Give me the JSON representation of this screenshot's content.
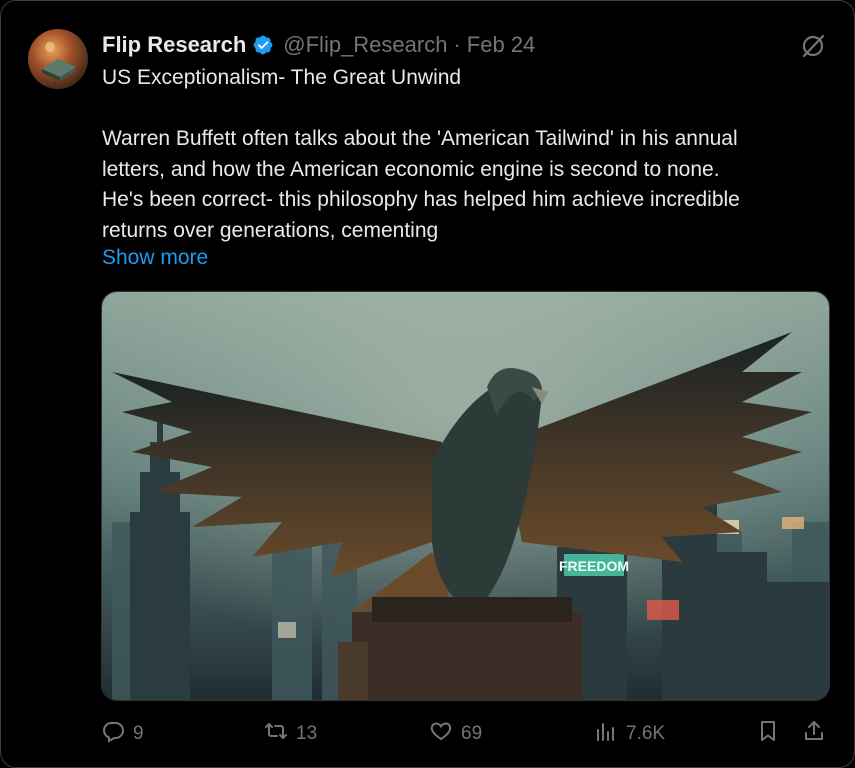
{
  "tweet": {
    "author_name": "Flip Research",
    "handle": "@Flip_Research",
    "separator": "·",
    "date": "Feb 24",
    "title": "US Exceptionalism- The Great Unwind",
    "body_lines": [
      "Warren Buffett often talks about the 'American Tailwind' in his annual",
      "letters, and how the American economic engine is second to none.",
      "He's been correct- this philosophy has helped him achieve incredible",
      "returns over generations, cementing"
    ],
    "show_more": "Show more",
    "image_sign_text": "FREEDOM"
  },
  "actions": {
    "replies": "9",
    "reposts": "13",
    "likes": "69",
    "views": "7.6K"
  },
  "icons": {
    "verified": "verified-badge-icon",
    "grok": "grok-icon",
    "reply": "reply-icon",
    "repost": "repost-icon",
    "like": "heart-icon",
    "views": "views-icon",
    "bookmark": "bookmark-icon",
    "share": "share-icon"
  },
  "colors": {
    "background": "#000000",
    "text": "#e7e9ea",
    "muted": "#71767b",
    "link": "#1d9bf0",
    "verified": "#1d9bf0"
  }
}
